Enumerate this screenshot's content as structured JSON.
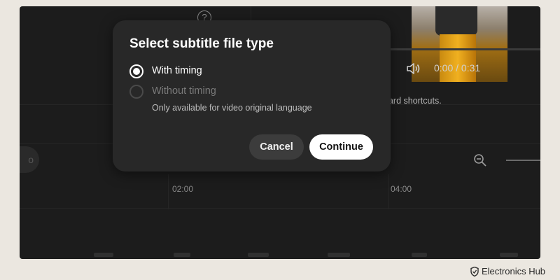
{
  "background": {
    "time_readout": "0:00 / 0:31",
    "shortcuts_text": "oard shortcuts.",
    "left_pill_text": "o",
    "timeline_ticks": [
      "02:00",
      "04:00"
    ]
  },
  "modal": {
    "title": "Select subtitle file type",
    "options": [
      {
        "label": "With timing",
        "selected": true,
        "enabled": true
      },
      {
        "label": "Without timing",
        "selected": false,
        "enabled": false
      }
    ],
    "hint": "Only available for video original language",
    "cancel_label": "Cancel",
    "continue_label": "Continue"
  },
  "watermark": {
    "brand": "Electronics Hub"
  },
  "colors": {
    "page_bg": "#ebe7e0",
    "app_bg": "#1c1c1c",
    "modal_bg": "#282828",
    "primary_button": "#ffffff",
    "secondary_button": "#3c3c3c"
  }
}
